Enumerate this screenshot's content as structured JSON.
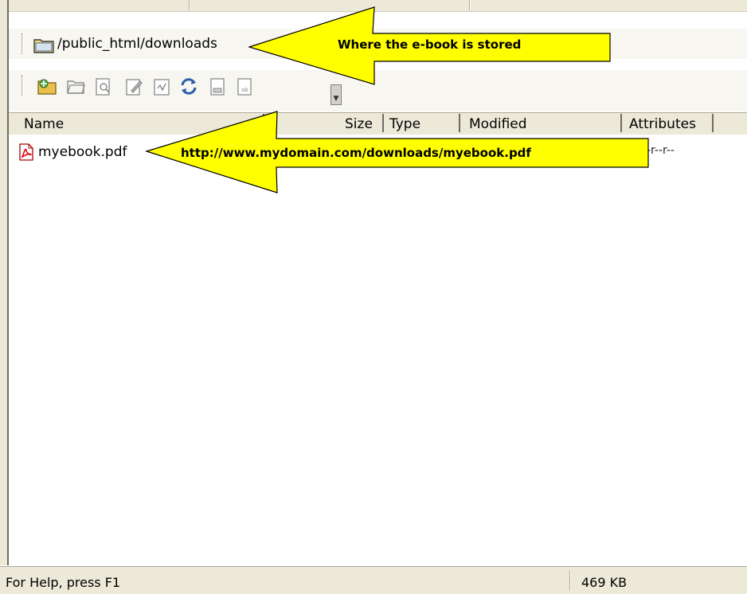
{
  "path_bar": {
    "path": "/public_html/downloads",
    "folder_icon": "folder-icon"
  },
  "toolbar": {
    "icons": [
      "new-folder-icon",
      "open-folder-icon",
      "view-file-icon",
      "edit-file-icon",
      "chmod-icon",
      "refresh-icon",
      "upload-icon",
      "download-icon"
    ],
    "more_icon": "toolbar-overflow-icon"
  },
  "list_header": {
    "name": "Name",
    "size": "Size",
    "type": "Type",
    "modified": "Modified",
    "attributes": "Attributes"
  },
  "files": [
    {
      "name": "myebook.pdf",
      "icon": "pdf-icon",
      "attributes_fragment": "-r--r--"
    }
  ],
  "annotations": {
    "path_callout": "Where the e-book is stored",
    "file_callout": "http://www.mydomain.com/downloads/myebook.pdf",
    "arrow_color": "#ffff00"
  },
  "status_bar": {
    "help": "For Help, press F1",
    "size": "469 KB"
  }
}
